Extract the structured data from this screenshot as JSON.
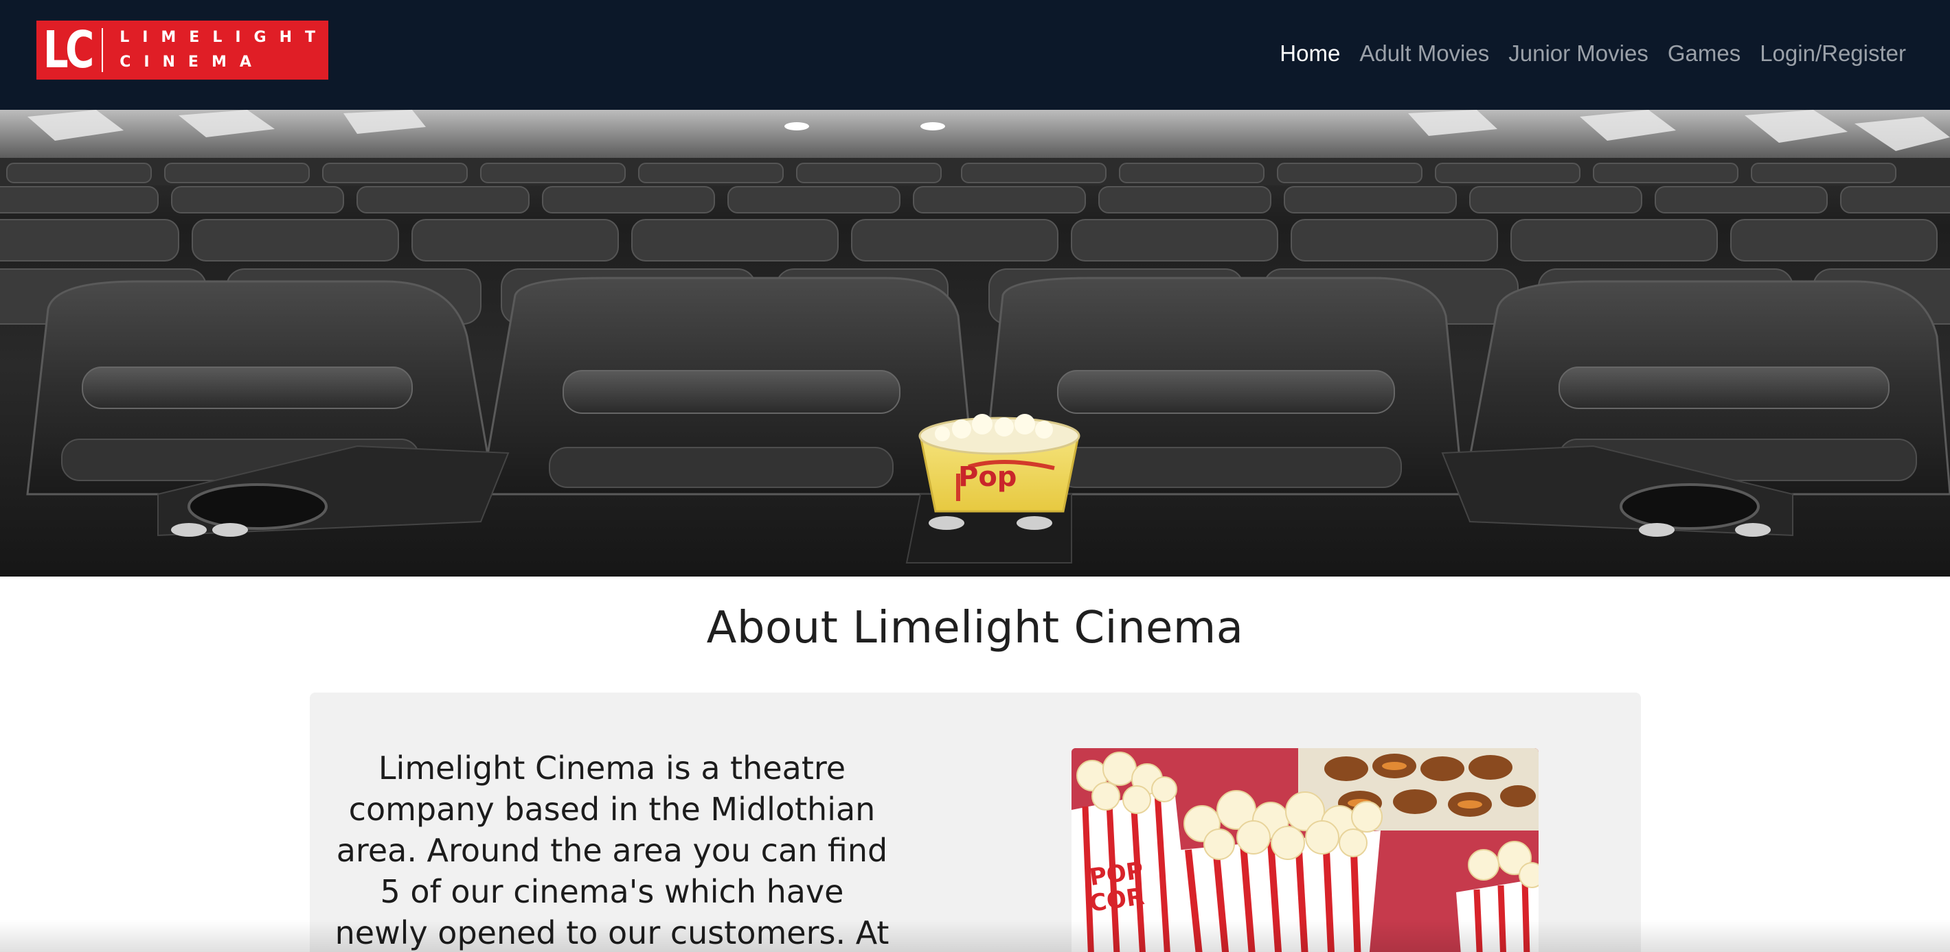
{
  "brand": {
    "mark": "LC",
    "line1": "LIMELIGHT",
    "line2": "CINEMA",
    "color": "#e01e26"
  },
  "nav": {
    "items": [
      {
        "label": "Home",
        "active": true
      },
      {
        "label": "Adult Movies",
        "active": false
      },
      {
        "label": "Junior Movies",
        "active": false
      },
      {
        "label": "Games",
        "active": false
      },
      {
        "label": "Login/Register",
        "active": false
      }
    ],
    "background": "#0c1829"
  },
  "hero": {
    "image": "cinema-seats-with-popcorn"
  },
  "about": {
    "title": "About Limelight Cinema",
    "text": "Limelight Cinema is a theatre company based in the Midlothian area. Around the area you can find 5 of our cinema's which have newly opened to our customers. At our cinema's we show",
    "image": "popcorn-boxes"
  }
}
